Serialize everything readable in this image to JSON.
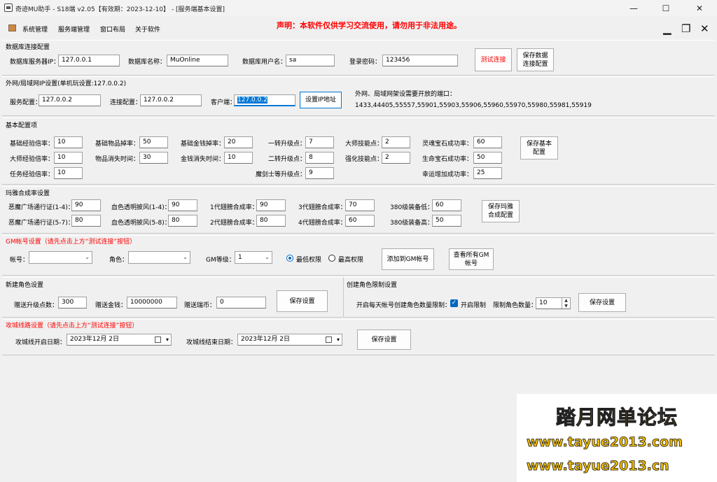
{
  "window": {
    "title": "奇迹MU助手 - S18端  v2.05【有效期：2023-12-10】 - [服务端基本设置]",
    "minimize": "—",
    "maximize": "☐",
    "close": "✕"
  },
  "menu": {
    "items": [
      "系统管理",
      "服务端管理",
      "窗口布局",
      "关于软件"
    ],
    "declaration": "声明：本软件仅供学习交流使用，请勿用于非法用途。",
    "mdi_minimize": "▁",
    "mdi_restore": "❐",
    "mdi_close": "✕"
  },
  "db": {
    "title": "数据库连接配置",
    "server_label": "数据库服务器IP：",
    "server_value": "127.0.0.1",
    "name_label": "数据库名称：",
    "name_value": "MuOnline",
    "user_label": "数据库用户名：",
    "user_value": "sa",
    "password_label": "登录密码：",
    "password_value": "123456",
    "test_button": "测试连接",
    "save_button": "保存数据连接配置"
  },
  "ip": {
    "title": "外网/局域网IP设置(单机玩设置:127.0.0.2)",
    "service_label": "服务配置：",
    "service_value": "127.0.0.2",
    "connect_label": "连接配置：",
    "connect_value": "127.0.0.2",
    "client_label": "客户端：",
    "client_value": "127.0.0.2",
    "set_button": "设置IP地址",
    "ports_label": "外网、局域网架设需要开放的端口：",
    "ports_value": "1433,44405,55557,55901,55903,55906,55960,55970,55980,55981,55919"
  },
  "basic": {
    "title": "基本配置项",
    "fields": [
      {
        "label": "基础经验倍率：",
        "value": "10"
      },
      {
        "label": "基础物品掉率：",
        "value": "50"
      },
      {
        "label": "基础金钱掉率：",
        "value": "20"
      },
      {
        "label": "一转升级点：",
        "value": "7"
      },
      {
        "label": "大师技能点：",
        "value": "2"
      },
      {
        "label": "灵魂宝石成功率：",
        "value": "60"
      },
      {
        "label": "大师经验倍率：",
        "value": "10"
      },
      {
        "label": "物品消失时间：",
        "value": "30"
      },
      {
        "label": "金钱消失时间：",
        "value": "10"
      },
      {
        "label": "二转升级点：",
        "value": "8"
      },
      {
        "label": "强化技能点：",
        "value": "2"
      },
      {
        "label": "生命宝石成功率：",
        "value": "50"
      },
      {
        "label": "任务经验倍率：",
        "value": "10"
      },
      {
        "label": "魔剑士等升级点：",
        "value": "9"
      },
      {
        "label": "幸运增加成功率：",
        "value": "25"
      }
    ],
    "save_button": "保存基本配置"
  },
  "maya": {
    "title": "玛雅合成率设置",
    "fields": [
      {
        "label": "恶魔广场通行证(1-4)：",
        "value": "90"
      },
      {
        "label": "血色透明披风(1-4)：",
        "value": "90"
      },
      {
        "label": "1代翅膀合成率：",
        "value": "90"
      },
      {
        "label": "3代翅膀合成率：",
        "value": "70"
      },
      {
        "label": "380级装备低：",
        "value": "60"
      },
      {
        "label": "恶魔广场通行证(5-7)：",
        "value": "80"
      },
      {
        "label": "血色透明披风(5-8)：",
        "value": "80"
      },
      {
        "label": "2代翅膀合成率：",
        "value": "80"
      },
      {
        "label": "4代翅膀合成率：",
        "value": "60"
      },
      {
        "label": "380级装备高：",
        "value": "50"
      }
    ],
    "save_button": "保存玛雅合成配置"
  },
  "gm": {
    "title": "GM帐号设置（请先点击上方“测试连接”按钮）",
    "account_label": "帐号：",
    "account_value": "",
    "role_label": "角色：",
    "role_value": "",
    "level_label": "GM等级：",
    "level_value": "1",
    "radio_low": "最低权限",
    "radio_high": "最高权限",
    "add_button": "添加到GM帐号",
    "view_button": "查看所有GM帐号"
  },
  "newrole": {
    "title": "新建角色设置",
    "points_label": "赠送升级点数：",
    "points_value": "300",
    "money_label": "赠送金钱：",
    "money_value": "10000000",
    "coin_label": "赠送瑞币：",
    "coin_value": "0",
    "save_button": "保存设置"
  },
  "limit": {
    "title": "创建角色限制设置",
    "daily_label": "开启每天帐号创建角色数量限制：",
    "enable_label": "开启限制",
    "count_label": "限制角色数量：",
    "count_value": "10",
    "save_button": "保存设置"
  },
  "siege": {
    "title": "攻城线路设置（请先点击上方“测试连接”按钮）",
    "start_label": "攻城线开启日期：",
    "start_value": "2023年12月  2日",
    "end_label": "攻城线结束日期：",
    "end_value": "2023年12月  2日",
    "save_button": "保存设置"
  },
  "watermark": {
    "line1": "踏月网单论坛",
    "line2": "www.tayue2013.com",
    "line3": "www.tayue2013.cn"
  }
}
